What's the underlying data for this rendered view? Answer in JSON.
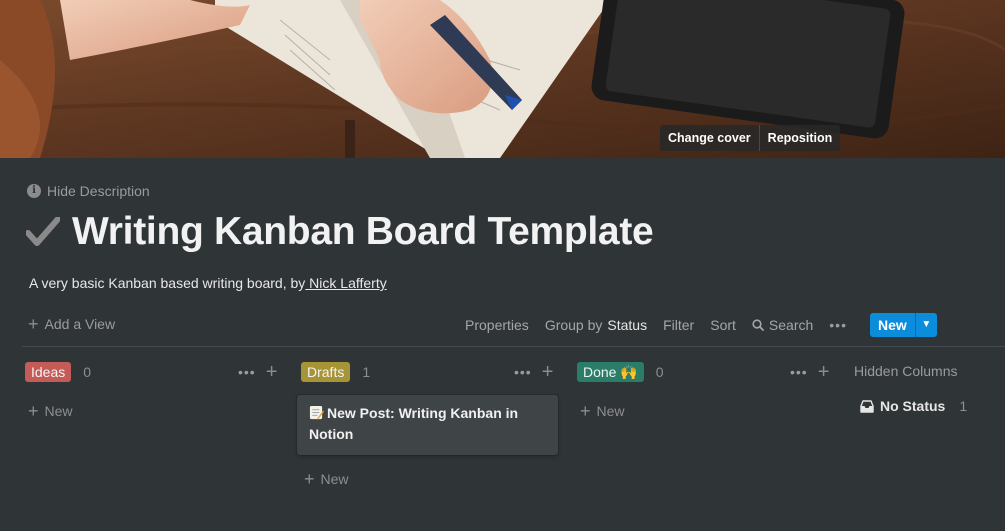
{
  "cover": {
    "change_cover_label": "Change cover",
    "reposition_label": "Reposition"
  },
  "header": {
    "hide_description_label": "Hide Description",
    "page_icon": "checkmark-icon",
    "title": "Writing Kanban Board Template",
    "description_prefix": "A very basic Kanban based writing board, by",
    "description_author": " Nick Lafferty"
  },
  "toolbar": {
    "add_view_label": "Add a View",
    "properties_label": "Properties",
    "group_by_prefix": "Group by",
    "group_by_value": "Status",
    "filter_label": "Filter",
    "sort_label": "Sort",
    "search_label": "Search",
    "new_label": "New"
  },
  "board": {
    "new_item_label": "New",
    "columns": [
      {
        "name": "Ideas",
        "count": "0",
        "color": "#c55b56",
        "cards": []
      },
      {
        "name": "Drafts",
        "count": "1",
        "color": "#a79436",
        "cards": [
          {
            "icon": "memo-icon",
            "title": "New Post: Writing Kanban in Notion"
          }
        ]
      },
      {
        "name": "Done 🙌",
        "count": "0",
        "color": "#2a7d68",
        "cards": []
      }
    ],
    "hidden_columns": {
      "title": "Hidden Columns",
      "items": [
        {
          "icon": "inbox-icon",
          "label": "No Status",
          "count": "1"
        }
      ]
    }
  },
  "colors": {
    "background": "#2f3437",
    "accent": "#0c8ddb"
  }
}
